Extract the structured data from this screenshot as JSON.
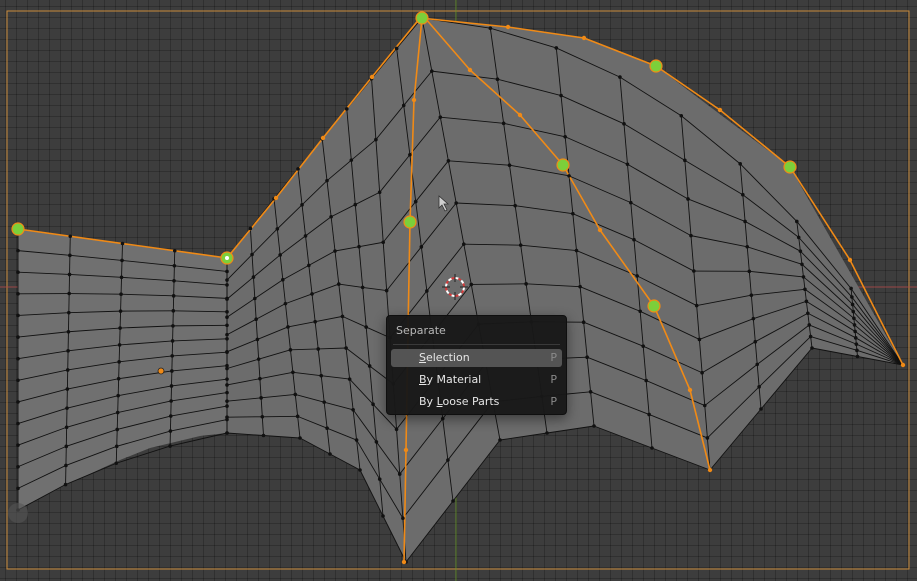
{
  "context_menu": {
    "title": "Separate",
    "items": [
      {
        "prefix": "",
        "mnemonic": "S",
        "rest": "election",
        "shortcut": "P",
        "active": true
      },
      {
        "prefix": "",
        "mnemonic": "B",
        "rest": "y Material",
        "shortcut": "P",
        "active": false
      },
      {
        "prefix": "By ",
        "mnemonic": "L",
        "rest": "oose Parts",
        "shortcut": "P",
        "active": false
      }
    ]
  },
  "colors": {
    "background": "#3d3d3d",
    "mesh_face": "#6f6f6f",
    "wire": "#111111",
    "selection_edge": "#f08a16",
    "selected_vertex_highlight": "#7ccf3a",
    "x_axis": "#b34a4a",
    "y_axis": "#6a9a2b",
    "menu_background": "#181818",
    "menu_active_item": "#545454"
  },
  "icons": [
    "3d-cursor-icon",
    "mouse-pointer-icon"
  ]
}
